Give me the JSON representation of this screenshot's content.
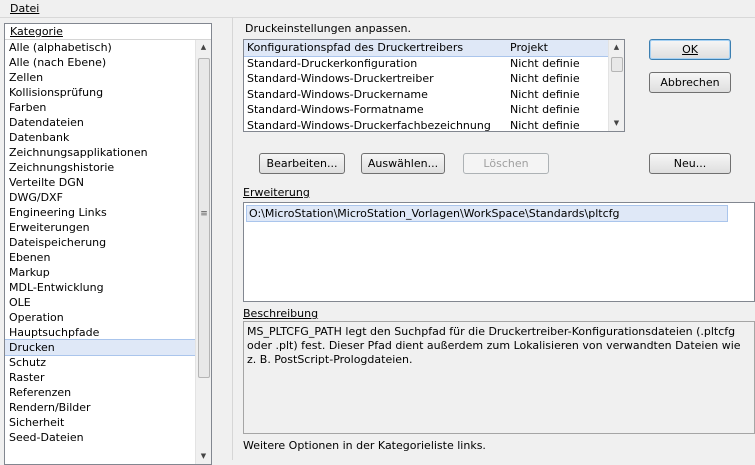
{
  "menu": {
    "file": "Datei"
  },
  "categories": {
    "header": "Kategorie",
    "items": [
      "Alle (alphabetisch)",
      "Alle (nach Ebene)",
      "Zellen",
      "Kollisionsprüfung",
      "Farben",
      "Datendateien",
      "Datenbank",
      "Zeichnungsapplikationen",
      "Zeichnungshistorie",
      "Verteilte DGN",
      "DWG/DXF",
      "Engineering Links",
      "Erweiterungen",
      "Dateispeicherung",
      "Ebenen",
      "Markup",
      "MDL-Entwicklung",
      "OLE",
      "Operation",
      "Hauptsuchpfade",
      "Drucken",
      "Schutz",
      "Raster",
      "Referenzen",
      "Rendern/Bilder",
      "Sicherheit",
      "Seed-Dateien"
    ],
    "selected": "Drucken"
  },
  "settings": {
    "title": "Druckeinstellungen anpassen.",
    "rows": [
      {
        "name": "Konfigurationspfad des Druckertreibers",
        "value": "Projekt"
      },
      {
        "name": "Standard-Druckerkonfiguration",
        "value": "Nicht definie"
      },
      {
        "name": "Standard-Windows-Druckertreiber",
        "value": "Nicht definie"
      },
      {
        "name": "Standard-Windows-Druckername",
        "value": "Nicht definie"
      },
      {
        "name": "Standard-Windows-Formatname",
        "value": "Nicht definie"
      },
      {
        "name": "Standard-Windows-Druckerfachbezeichnung",
        "value": "Nicht definie"
      }
    ]
  },
  "buttons": {
    "ok": "OK",
    "cancel": "Abbrechen",
    "edit": "Bearbeiten...",
    "select": "Auswählen...",
    "delete": "Löschen",
    "new": "Neu..."
  },
  "extension": {
    "label": "Erweiterung",
    "value": "O:\\MicroStation\\MicroStation_Vorlagen\\WorkSpace\\Standards\\pltcfg"
  },
  "description": {
    "label": "Beschreibung",
    "text": "MS_PLTCFG_PATH legt den Suchpfad für die Druckertreiber-Konfigurationsdateien (.pltcfg oder .plt) fest. Dieser Pfad dient außerdem zum Lokalisieren von verwandten Dateien wie z. B. PostScript-Prologdateien."
  },
  "footer": "Weitere Optionen in der Kategorieliste links."
}
